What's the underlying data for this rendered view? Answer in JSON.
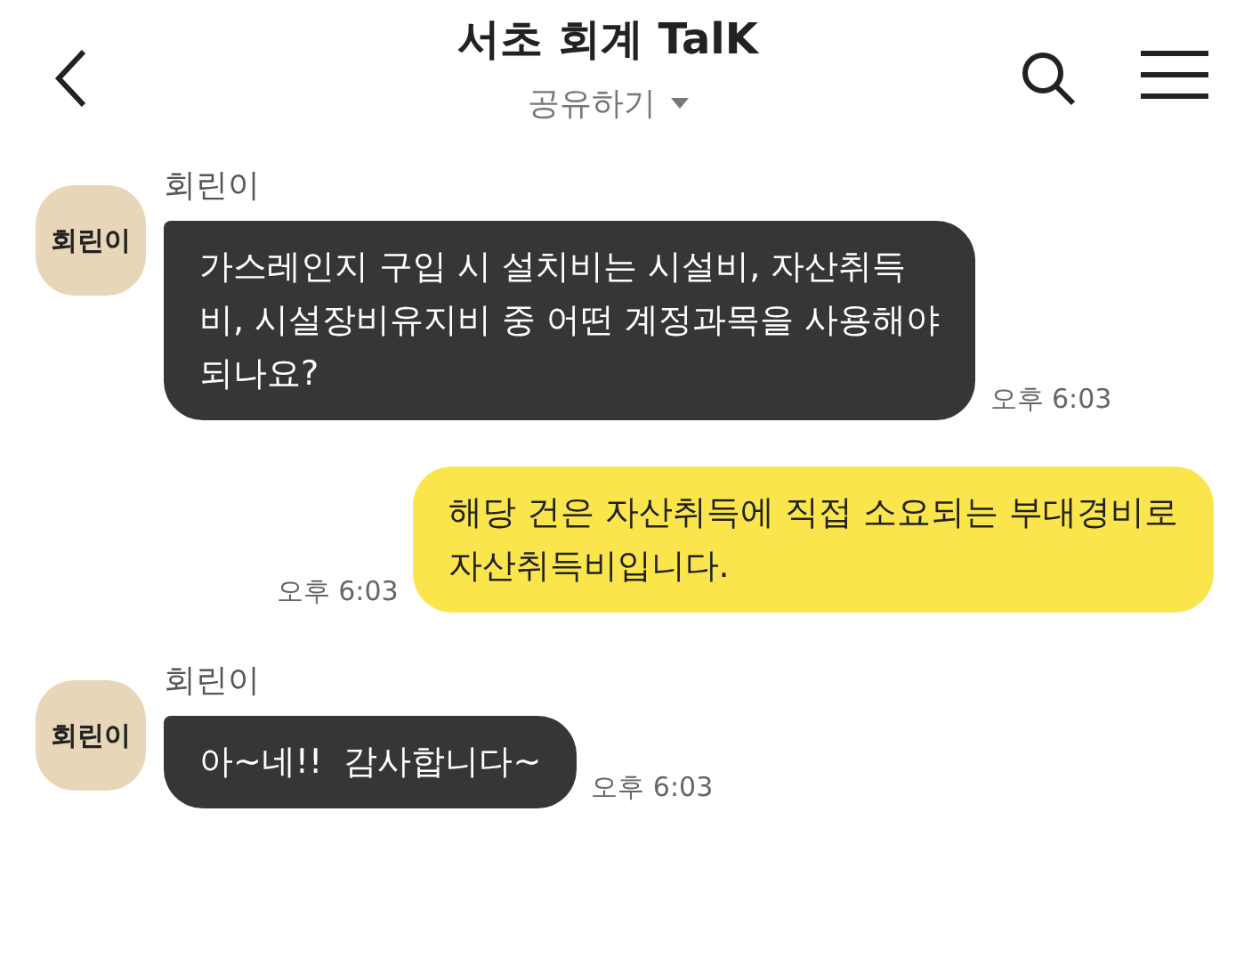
{
  "header": {
    "title": "서초 회계 TalK",
    "subtitle": "공유하기"
  },
  "messages": [
    {
      "kind": "received",
      "avatar": "회린이",
      "sender": "회린이",
      "text": "가스레인지 구입 시 설치비는 시설비, 자산취득\n비, 시설장비유지비 중 어떤 계정과목을 사용해야\n되나요?",
      "time": "오후 6:03"
    },
    {
      "kind": "sent",
      "text": "해당 건은 자산취득에 직접 소요되는 부대경비로\n자산취득비입니다.",
      "time": "오후 6:03"
    },
    {
      "kind": "received",
      "avatar": "회린이",
      "sender": "회린이",
      "text": "아~네!!  감사합니다~",
      "time": "오후 6:03"
    }
  ]
}
